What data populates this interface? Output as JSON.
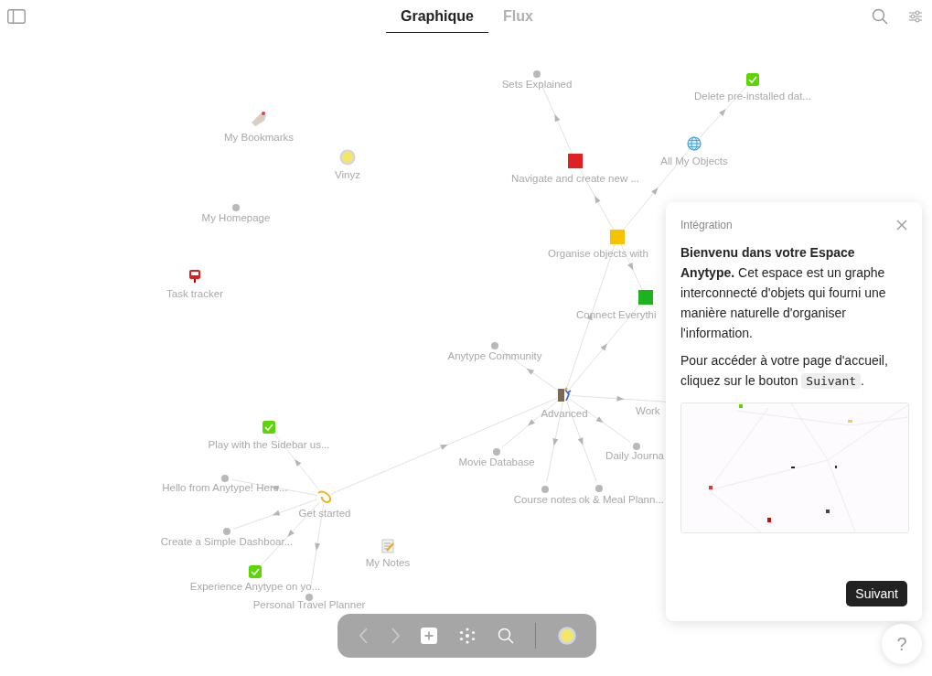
{
  "header": {
    "tabs": [
      {
        "label": "Graphique",
        "selected": true
      },
      {
        "label": "Flux",
        "selected": false
      }
    ]
  },
  "graph": {
    "nodes": [
      {
        "label": "Sets Explained",
        "kind": "dot"
      },
      {
        "label": "Delete pre-installed dat...",
        "kind": "check"
      },
      {
        "label": "My Bookmarks",
        "kind": "icon"
      },
      {
        "label": "Vinyz",
        "kind": "icon"
      },
      {
        "label": "All My Objects",
        "kind": "icon"
      },
      {
        "label": "Navigate and create new ...",
        "kind": "square",
        "color": "#e02020"
      },
      {
        "label": "My Homepage",
        "kind": "dot"
      },
      {
        "label": "Organise objects with",
        "kind": "square",
        "color": "#f5c400"
      },
      {
        "label": "Task tracker",
        "kind": "icon"
      },
      {
        "label": "Connect Everythi",
        "kind": "square",
        "color": "#1db31d"
      },
      {
        "label": "Anytype Community",
        "kind": "dot"
      },
      {
        "label": "Advanced",
        "kind": "icon"
      },
      {
        "label": "Work",
        "kind": "hidden"
      },
      {
        "label": "Play with the Sidebar us...",
        "kind": "check"
      },
      {
        "label": "Daily Journa",
        "kind": "dot"
      },
      {
        "label": "Movie Database",
        "kind": "dot"
      },
      {
        "label": "Hello from Anytype! Here...",
        "kind": "dot"
      },
      {
        "label": "Course notes",
        "kind": "dot"
      },
      {
        "label": "ok & Meal Plann...",
        "kind": "dot"
      },
      {
        "label": "Get started",
        "kind": "icon"
      },
      {
        "label": "Create a Simple Dashboar...",
        "kind": "dot"
      },
      {
        "label": "My Notes",
        "kind": "icon"
      },
      {
        "label": "Experience Anytype on yo...",
        "kind": "check"
      },
      {
        "label": "Personal Travel Planner",
        "kind": "dot"
      }
    ]
  },
  "onboarding": {
    "title": "Intégration",
    "intro": "**Bienvenu dans votre Espace Anytype.** Cet espace est un graphe interconnecté d'objets qui fourni une manière naturelle d'organiser l'information.",
    "hint_before": "Pour accéder à votre page d'accueil, cliquez sur le bouton",
    "hint_code": "Suivant",
    "hint_after": ".",
    "next_button": "Suivant"
  },
  "toolbar": {
    "back": {
      "disabled": true
    },
    "forward": {
      "disabled": true
    }
  },
  "help_button": "?"
}
